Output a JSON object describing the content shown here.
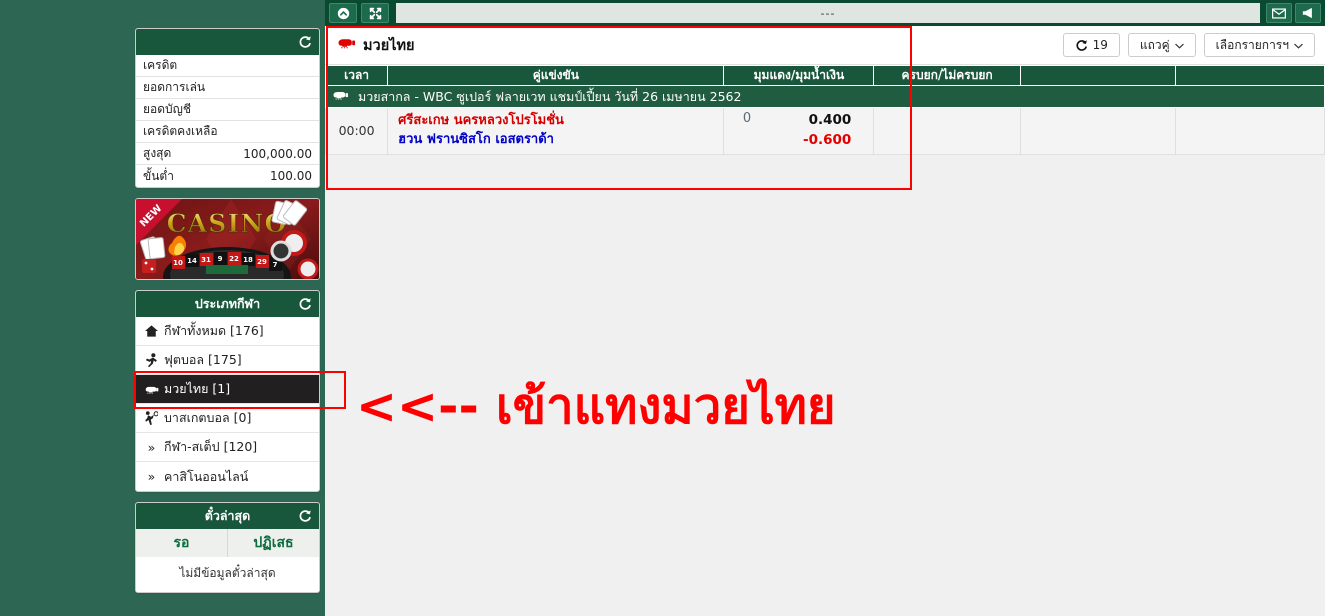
{
  "topbar": {
    "marquee_text": "---",
    "buttons": [
      {
        "name": "collapse-button",
        "icon": "chevron-up-circle-icon"
      },
      {
        "name": "fullscreen-button",
        "icon": "expand-arrows-icon"
      }
    ],
    "right_icons": [
      {
        "name": "messages-button",
        "icon": "envelope-icon"
      },
      {
        "name": "announcement-button",
        "icon": "megaphone-icon"
      }
    ]
  },
  "sidebar": {
    "balance_panel": {
      "title": "",
      "refresh_icon": "refresh-icon",
      "rows": [
        {
          "label": "เครดิต",
          "value": ""
        },
        {
          "label": "ยอดการเล่น",
          "value": ""
        },
        {
          "label": "ยอดบัญชี",
          "value": ""
        },
        {
          "label": "เครดิตคงเหลือ",
          "value": ""
        },
        {
          "label": "สูงสุด",
          "value": "100,000.00"
        },
        {
          "label": "ขั้นต่ำ",
          "value": "100.00"
        }
      ]
    },
    "casino_banner": {
      "badge": "NEW",
      "wordmark": "CASINO",
      "roulette_numbers": [
        "10",
        "14",
        "31",
        "9",
        "22",
        "18",
        "29",
        "7"
      ]
    },
    "sports_panel": {
      "title": "ประเภทกีฬา",
      "refresh_icon": "refresh-icon",
      "items": [
        {
          "label": "กีฬาทั้งหมด [176]",
          "icon": "home-icon",
          "active": false
        },
        {
          "label": "ฟุตบอล [175]",
          "icon": "soccer-player-icon",
          "active": false
        },
        {
          "label": "มวยไทย [1]",
          "icon": "boxing-glove-icon",
          "active": true
        },
        {
          "label": "บาสเกตบอล [0]",
          "icon": "basketball-player-icon",
          "active": false
        },
        {
          "label": "กีฬา-สเต็ป [120]",
          "icon": "chevron-double-icon",
          "active": false
        },
        {
          "label": "คาสิโนออนไลน์",
          "icon": "chevron-double-icon",
          "active": false
        }
      ]
    },
    "ticket_panel": {
      "title": "ตั๋วล่าสุด",
      "refresh_icon": "refresh-icon",
      "tabs": [
        "รอ",
        "ปฏิเสธ"
      ],
      "empty_text": "ไม่มีข้อมูลตั๋วล่าสุด"
    }
  },
  "content": {
    "title": "มวยไทย",
    "title_icon": "boxing-glove-icon",
    "tools": [
      {
        "name": "refresh-counter",
        "icon": "refresh-icon",
        "label": "19"
      },
      {
        "name": "row-mode-select",
        "label": "แถวคู่",
        "icon": "chevron-down-icon"
      },
      {
        "name": "list-filter-select",
        "label": "เลือกรายการฯ",
        "icon": "chevron-down-icon"
      }
    ],
    "table": {
      "headers": [
        "เวลา",
        "คู่แข่งขัน",
        "มุมแดง/มุมน้ำเงิน",
        "ครบยก/ไม่ครบยก",
        "",
        ""
      ],
      "league": {
        "icon": "boxing-glove-icon",
        "name": "มวยสากล - WBC ซูเปอร์ ฟลายเวท แชมป์เปี้ยน วันที่ 26 เมษายน 2562"
      },
      "rows": [
        {
          "time": "00:00",
          "home": "ศรีสะเกษ นครหลวงโปรโมชั่น",
          "away": "ฮวน ฟรานซิสโก เอสตราด้า",
          "score": "0",
          "odds_home": "0.400",
          "odds_away": "-0.600"
        }
      ]
    }
  },
  "annotations": {
    "callout_text": "<<-- เข้าแทงมวยไทย",
    "callout_color": "#ff0000"
  }
}
